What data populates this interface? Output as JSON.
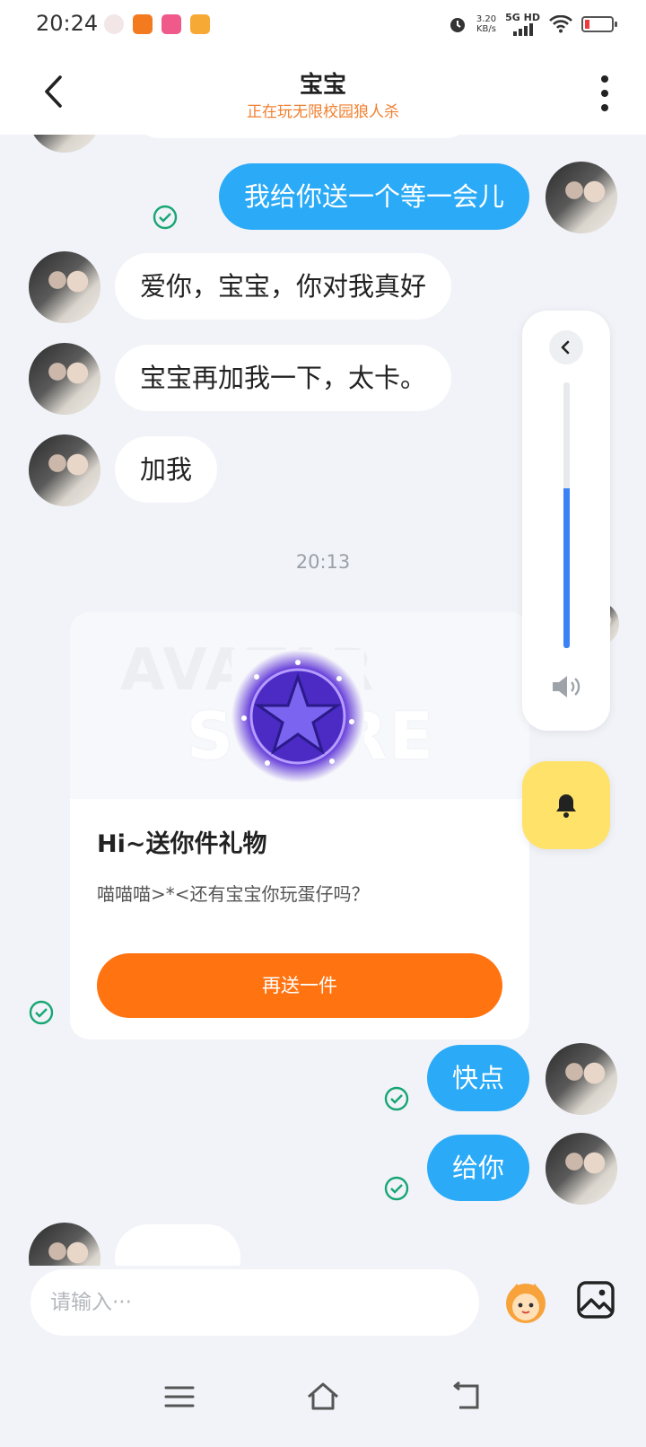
{
  "status_bar": {
    "time": "20:24",
    "speed_value": "3.20",
    "speed_unit": "KB/s",
    "network": "5G HD",
    "icons": [
      "avatar-app-icon",
      "app-icon-orange",
      "app-icon-pink",
      "video-app-icon",
      "alarm-icon",
      "signal-icon",
      "wifi-icon",
      "battery-icon"
    ]
  },
  "header": {
    "title": "宝宝",
    "subtitle": "正在玩无限校园狼人杀"
  },
  "messages": [
    {
      "side": "out",
      "text": "我给你送一个等一会儿",
      "read": true
    },
    {
      "side": "in",
      "text": "爱你，宝宝，你对我真好"
    },
    {
      "side": "in",
      "text": "宝宝再加我一下，太卡。"
    },
    {
      "side": "in",
      "text": "加我"
    },
    {
      "side": "out",
      "text": "快点",
      "read": true
    },
    {
      "side": "out",
      "text": "给你",
      "read": true
    }
  ],
  "timestamp": "20:13",
  "gift_card": {
    "watermark_line1": "AVATAR",
    "watermark_line2": "STORE",
    "title": "Hi~送你件礼物",
    "description": "喵喵喵>*<还有宝宝你玩蛋仔吗？",
    "button_label": "再送一件"
  },
  "volume": {
    "level": 0.6
  },
  "input": {
    "placeholder": "请输入···"
  },
  "colors": {
    "accent_blue": "#2aaaf7",
    "subtitle_orange": "#f08030",
    "gift_button_orange": "#ff7310",
    "read_check_green": "#17a673",
    "bell_yellow": "#ffe26a",
    "volume_blue": "#3b82f6"
  }
}
